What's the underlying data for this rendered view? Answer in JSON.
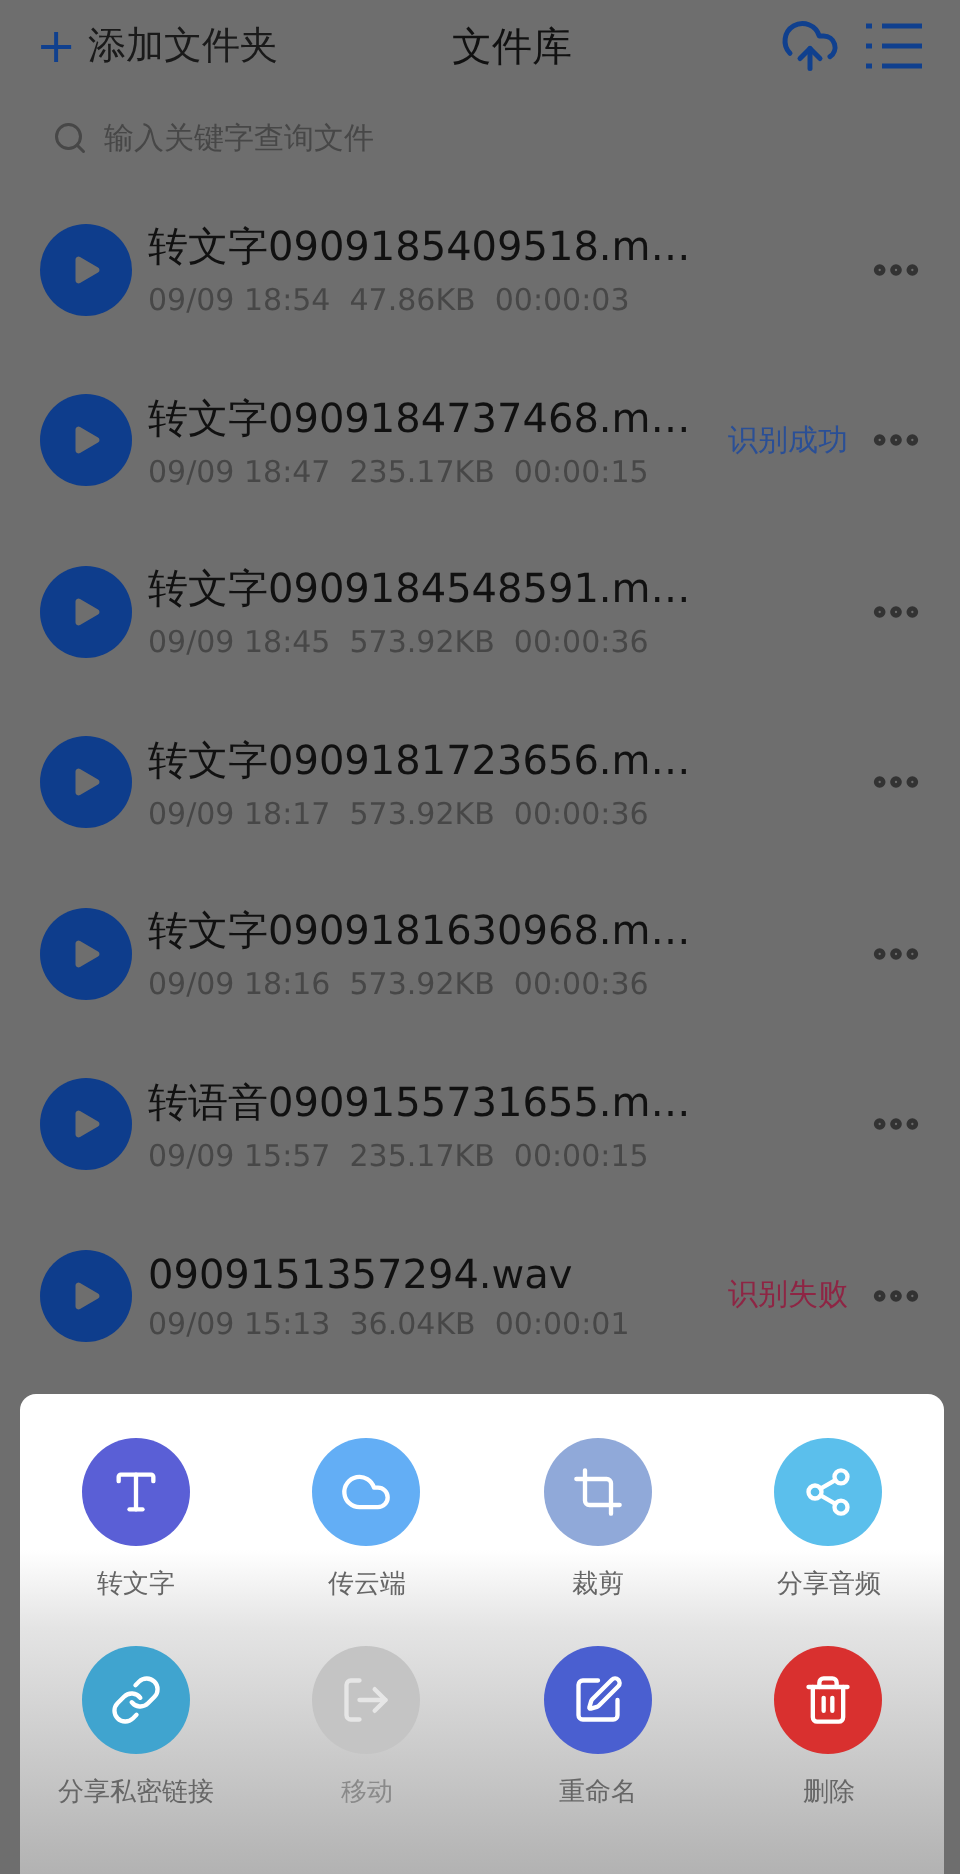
{
  "header": {
    "add_folder": "添加文件夹",
    "add_icon": "+",
    "title": "文件库"
  },
  "search": {
    "placeholder": "输入关键字查询文件"
  },
  "files": [
    {
      "name": "转文字0909185409518.m…",
      "meta": "09/09 18:54  47.86KB  00:00:03"
    },
    {
      "name": "转文字0909184737468.m…",
      "meta": "09/09 18:47  235.17KB  00:00:15",
      "status": {
        "text": "识别成功",
        "color": "#2a4f96"
      }
    },
    {
      "name": "转文字0909184548591.m…",
      "meta": "09/09 18:45  573.92KB  00:00:36"
    },
    {
      "name": "转文字0909181723656.m…",
      "meta": "09/09 18:17  573.92KB  00:00:36"
    },
    {
      "name": "转文字0909181630968.m…",
      "meta": "09/09 18:16  573.92KB  00:00:36"
    },
    {
      "name": "转语音0909155731655.m…",
      "meta": "09/09 15:57  235.17KB  00:00:15"
    },
    {
      "name": "0909151357294.wav",
      "meta": "09/09 15:13  36.04KB  00:00:01",
      "status": {
        "text": "识别失败",
        "color": "#8e2544"
      }
    }
  ],
  "actions": [
    {
      "kind": "text",
      "label": "转文字",
      "color": "#5a5fd6",
      "disabled": false
    },
    {
      "kind": "cloud",
      "label": "传云端",
      "color": "#63aef5",
      "disabled": false
    },
    {
      "kind": "crop",
      "label": "裁剪",
      "color": "#90a9d9",
      "disabled": false
    },
    {
      "kind": "share",
      "label": "分享音频",
      "color": "#5bbfec",
      "disabled": false
    },
    {
      "kind": "link",
      "label": "分享私密链接",
      "color": "#40a4cf",
      "disabled": false
    },
    {
      "kind": "move",
      "label": "移动",
      "disabled": true
    },
    {
      "kind": "rename",
      "label": "重命名",
      "color": "#4a5fd0",
      "disabled": false
    },
    {
      "kind": "delete",
      "label": "删除",
      "color": "#d9302f",
      "disabled": false
    }
  ]
}
